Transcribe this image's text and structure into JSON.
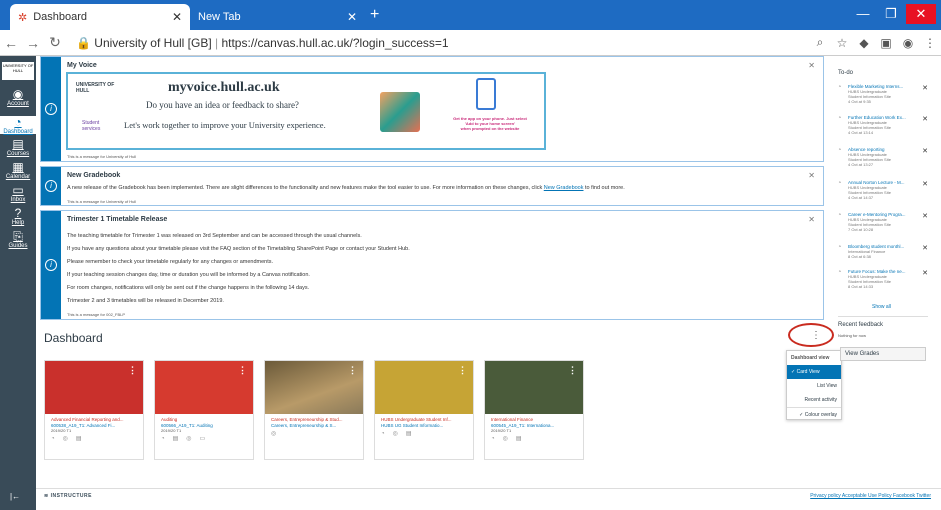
{
  "browser": {
    "tabs": [
      {
        "label": "Dashboard",
        "active": true
      },
      {
        "label": "New Tab",
        "active": false
      }
    ],
    "url_site": "University of Hull [GB]",
    "url": "https://canvas.hull.ac.uk/?login_success=1"
  },
  "leftnav": {
    "logo_text": "UNIVERSITY OF HULL",
    "items": [
      {
        "label": "Account",
        "icon": "user-icon"
      },
      {
        "label": "Dashboard",
        "icon": "dashboard-icon"
      },
      {
        "label": "Courses",
        "icon": "book-icon"
      },
      {
        "label": "Calendar",
        "icon": "calendar-icon"
      },
      {
        "label": "Inbox",
        "icon": "inbox-icon"
      },
      {
        "label": "Help",
        "icon": "help-icon"
      },
      {
        "label": "Guides",
        "icon": "guides-icon"
      }
    ]
  },
  "announcements": [
    {
      "title": "My Voice",
      "footer": "This is a message for University of Hull",
      "banner": {
        "logo": "UNIVERSITY OF HULL",
        "heading": "myvoice.hull.ac.uk",
        "line1": "Do you have an idea or feedback to share?",
        "line2": "Let's work together to improve your University experience.",
        "app_note1": "Get the app on your phone. Just select",
        "app_note2": "'Add to your home screen'",
        "app_note3": "when prompted on the website",
        "student_services": "Student services"
      }
    },
    {
      "title": "New Gradebook",
      "body_before": "A new release of the Gradebook has been implemented.  There are slight differences to the functionality and new features make the tool easier to use.  For more information on these changes, click ",
      "body_link": "New Gradebook",
      "body_after": " to find out more.",
      "footer": "This is a message for University of Hull"
    },
    {
      "title": "Trimester 1 Timetable Release",
      "lines": [
        "The teaching timetable for Trimester 1 was released on 3rd September and can be accessed through the usual channels.",
        "If you have any questions about your timetable please visit the FAQ section of the Timetabling SharePoint Page or contact your Student Hub.",
        "Please remember to check your timetable regularly for any changes or amendments.",
        "If your teaching session changes day, time or duration you will be informed by a Canvas notification.",
        "For room changes, notifications will only be sent out if the change happens in the following 14 days.",
        "Trimester 2 and 3 timetables will be released in December 2019."
      ],
      "footer": "This is a message for 002_FBLP"
    }
  ],
  "dashboard": {
    "title": "Dashboard",
    "menu": {
      "header": "Dashboard view",
      "items": [
        {
          "label": "Card View",
          "selected": true
        },
        {
          "label": "List View",
          "selected": false
        },
        {
          "label": "Recent activity",
          "selected": false
        },
        {
          "label": "Colour overlay",
          "checked": true
        }
      ]
    },
    "cards": [
      {
        "title": "Advanced Financial Reporting and...",
        "code": "600538_A19_T1: Advanced Fi...",
        "term": "2019/20 T1",
        "color": "#c9302c"
      },
      {
        "title": "Auditing",
        "code": "600566_A19_T1: Auditing",
        "term": "2019/20 T1",
        "color": "#d63a2f"
      },
      {
        "title": "Careers, Entrepreneurship & Stud...",
        "code": "Careers, Entrepreneurship & S...",
        "term": "",
        "color": "#8a7a5a"
      },
      {
        "title": "HUBS Undergraduate Student Inf...",
        "code": "HUBS UG Student Informatio...",
        "term": "",
        "color": "#c6a435"
      },
      {
        "title": "International Finance",
        "code": "600545_A19_T1: Internationa...",
        "term": "2019/20 T1",
        "color": "#4a5b3a"
      }
    ]
  },
  "sidebar": {
    "todo_title": "To-do",
    "todo": [
      {
        "title": "Flexible Marketing Interns...",
        "sub1": "HUBS Undergraduate",
        "sub2": "Student Information Site",
        "date": "4 Oct at 9:35"
      },
      {
        "title": "Further Education Work Ex...",
        "sub1": "HUBS Undergraduate",
        "sub2": "Student Information Site",
        "date": "4 Oct at 13:14"
      },
      {
        "title": "Absence reporting",
        "sub1": "HUBS Undergraduate",
        "sub2": "Student Information Site",
        "date": "4 Oct at 13:27"
      },
      {
        "title": "Annual Norton Lecture - M...",
        "sub1": "HUBS Undergraduate",
        "sub2": "Student Information Site",
        "date": "4 Oct at 14:37"
      },
      {
        "title": "Career e-Mentoring Progra...",
        "sub1": "HUBS Undergraduate",
        "sub2": "Student Information Site",
        "date": "7 Oct at 10:28"
      },
      {
        "title": "Bloomberg student monthl...",
        "sub1": "International Finance",
        "sub2": "",
        "date": "8 Oct at 6:38"
      },
      {
        "title": "Future Focus: Make the ne...",
        "sub1": "HUBS Undergraduate",
        "sub2": "Student Information Site",
        "date": "8 Oct at 14:33"
      }
    ],
    "show_all": "Show all",
    "feedback_title": "Recent feedback",
    "feedback_none": "Nothing for now",
    "view_grades": "View Grades"
  },
  "footer": {
    "brand": "INSTRUCTURE",
    "links": "Privacy policy  Acceptable Use Policy  Facebook  Twitter"
  }
}
